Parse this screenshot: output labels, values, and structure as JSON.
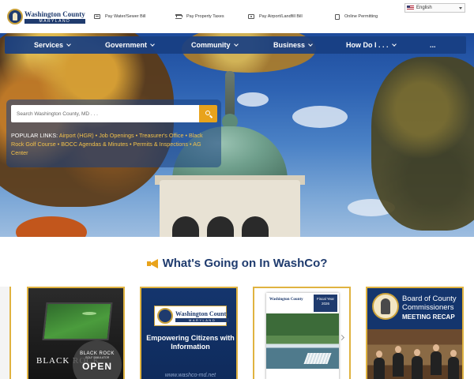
{
  "header": {
    "logo": {
      "name": "Washington County",
      "state": "MARYLAND"
    },
    "utility_links": [
      {
        "label": "Pay Water/Sewer Bill",
        "icon": "bill-icon"
      },
      {
        "label": "Pay Property Taxes",
        "icon": "bank-icon"
      },
      {
        "label": "Pay Airport/Landfill Bill",
        "icon": "payment-icon"
      },
      {
        "label": "Online Permitting",
        "icon": "document-icon"
      }
    ],
    "language": "English"
  },
  "nav": {
    "items": [
      {
        "label": "Services"
      },
      {
        "label": "Government"
      },
      {
        "label": "Community"
      },
      {
        "label": "Business"
      },
      {
        "label": "How Do I . . ."
      },
      {
        "label": "..."
      }
    ]
  },
  "search": {
    "placeholder": "Search Washington County, MD . . ."
  },
  "popular_links": {
    "label": "POPULAR LINKS:",
    "links": [
      "Airport (HGR)",
      "Job Openings",
      "Treasurer's Office",
      "Black Rock Golf Course",
      "BOCC Agendas & Minutes",
      "Permits & Inspections",
      "AG Center"
    ]
  },
  "section": {
    "title": "What's Going on In WashCo?"
  },
  "cards": {
    "black_rock": {
      "brand": "BLACK ROCK",
      "badge_top": "BLACK ROCK",
      "badge_sub": "GOLF SIMULATOR",
      "badge_main": "OPEN"
    },
    "empowering": {
      "logo_name": "Washington County",
      "logo_state": "MARYLAND",
      "text": "Empowering Citizens with Information",
      "url": "www.washco-md.net"
    },
    "budget": {
      "logo": "Washington County",
      "fiscal": "Fiscal Year 2026"
    },
    "bocc": {
      "title": "Board of County Commissioners",
      "subtitle": "MEETING RECAP"
    }
  },
  "colors": {
    "brand_navy": "#1f3b6e",
    "nav_blue": "#183f82",
    "accent_gold": "#e8a31c",
    "link_gold": "#f2c14a"
  }
}
